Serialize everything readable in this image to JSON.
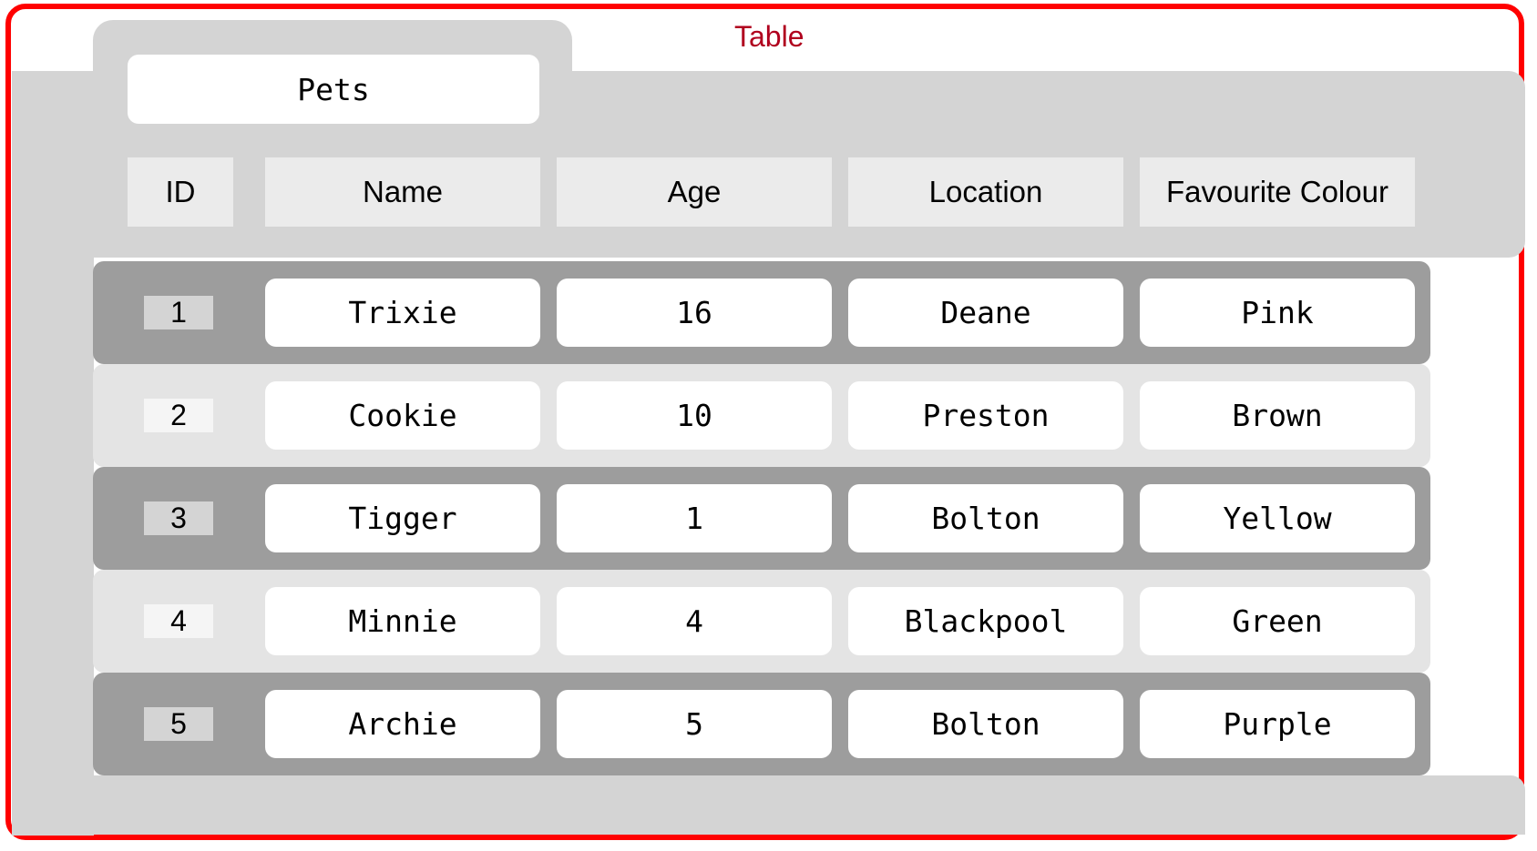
{
  "caption": "Table",
  "table": {
    "title": "Pets",
    "headers": [
      "ID",
      "Name",
      "Age",
      "Location",
      "Favourite Colour"
    ],
    "rows": [
      {
        "id": "1",
        "name": "Trixie",
        "age": "16",
        "location": "Deane",
        "colour": "Pink"
      },
      {
        "id": "2",
        "name": "Cookie",
        "age": "10",
        "location": "Preston",
        "colour": "Brown"
      },
      {
        "id": "3",
        "name": "Tigger",
        "age": "1",
        "location": "Bolton",
        "colour": "Yellow"
      },
      {
        "id": "4",
        "name": "Minnie",
        "age": "4",
        "location": "Blackpool",
        "colour": "Green"
      },
      {
        "id": "5",
        "name": "Archie",
        "age": "5",
        "location": "Bolton",
        "colour": "Purple"
      }
    ]
  },
  "colors": {
    "frame_border": "#ff0000",
    "caption": "#b0001e",
    "container": "#d4d4d4",
    "row_dark": "#9d9d9d",
    "row_light": "#e4e4e4",
    "header_cell": "#ebebeb",
    "cell": "#ffffff"
  }
}
